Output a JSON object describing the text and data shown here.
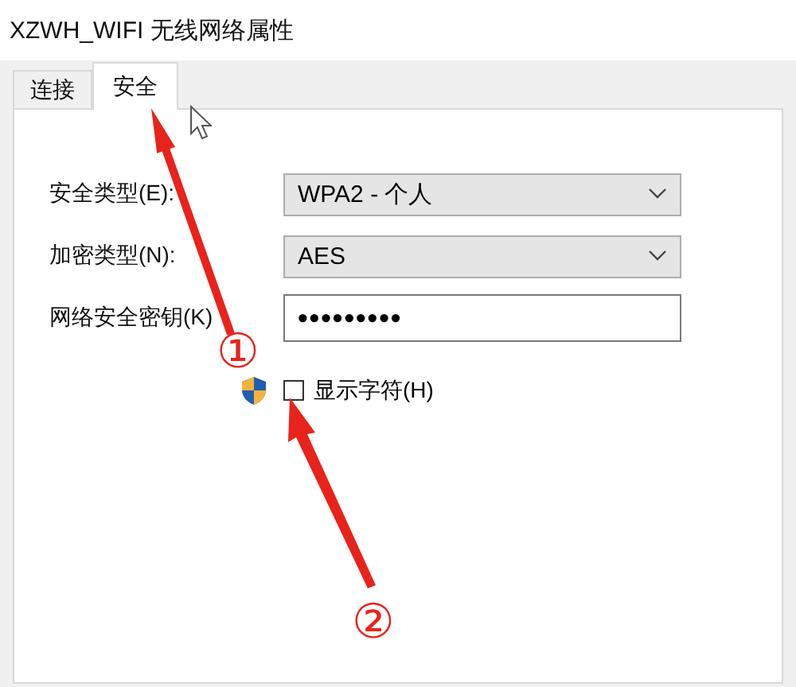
{
  "window": {
    "title": "XZWH_WIFI 无线网络属性"
  },
  "tabs": [
    {
      "label": "连接",
      "selected": false
    },
    {
      "label": "安全",
      "selected": true
    }
  ],
  "fields": [
    {
      "kind": "dropdown",
      "label": "安全类型(E):",
      "value": "WPA2 - 个人"
    },
    {
      "kind": "dropdown",
      "label": "加密类型(N):",
      "value": "AES"
    },
    {
      "kind": "password",
      "label": "网络安全密钥(K)",
      "value": "•••••••••"
    }
  ],
  "show_characters": {
    "label": "显示字符(H)",
    "checked": false
  },
  "annotations": [
    {
      "label": "①"
    },
    {
      "label": "②"
    }
  ]
}
